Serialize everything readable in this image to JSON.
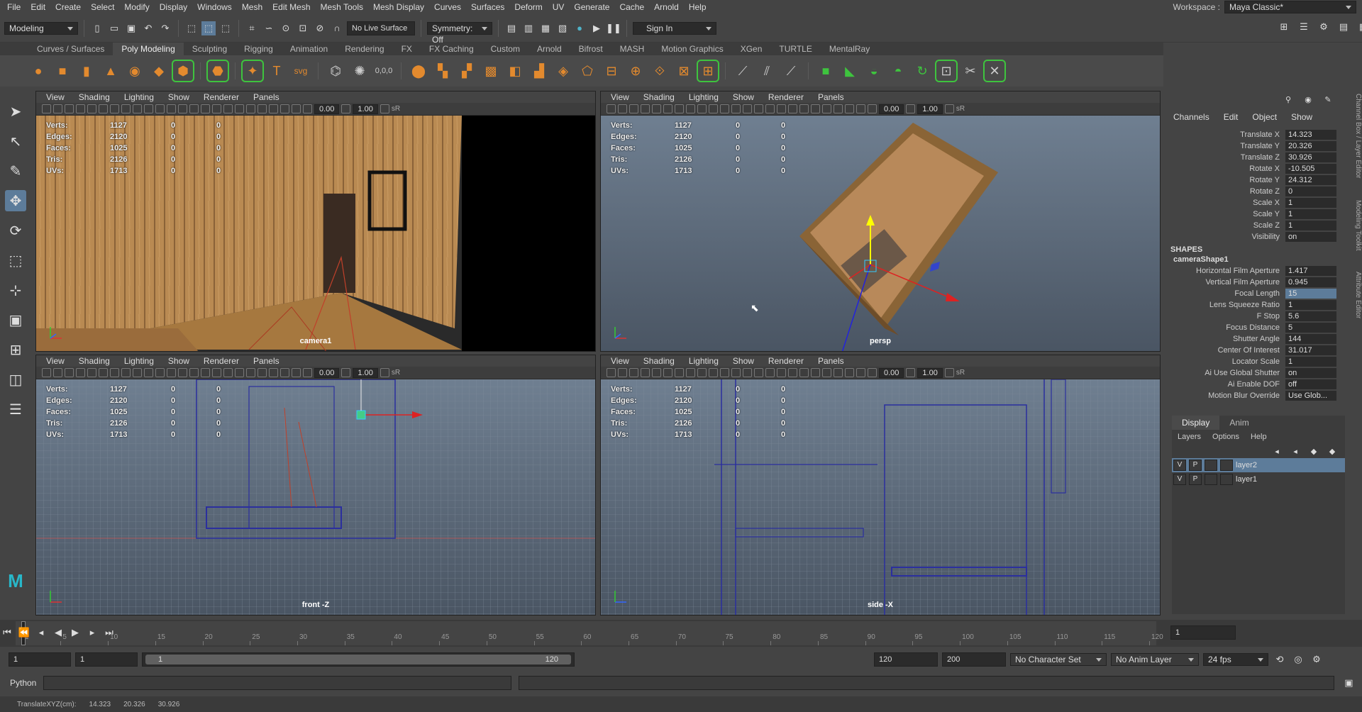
{
  "menubar": {
    "items": [
      "File",
      "Edit",
      "Create",
      "Select",
      "Modify",
      "Display",
      "Windows",
      "Mesh",
      "Edit Mesh",
      "Mesh Tools",
      "Mesh Display",
      "Curves",
      "Surfaces",
      "Deform",
      "UV",
      "Generate",
      "Cache",
      "Arnold",
      "Help"
    ],
    "workspace_label": "Workspace :",
    "workspace_value": "Maya Classic*"
  },
  "statusline": {
    "mode": "Modeling",
    "live_surface": "No Live Surface",
    "symmetry": "Symmetry: Off",
    "sign_in": "Sign In"
  },
  "shelf": {
    "tabs": [
      "Curves / Surfaces",
      "Poly Modeling",
      "Sculpting",
      "Rigging",
      "Animation",
      "Rendering",
      "FX",
      "FX Caching",
      "Custom",
      "Arnold",
      "Bifrost",
      "MASH",
      "Motion Graphics",
      "XGen",
      "TURTLE",
      "MentalRay"
    ],
    "active": "Poly Modeling"
  },
  "viewport_menu": [
    "View",
    "Shading",
    "Lighting",
    "Show",
    "Renderer",
    "Panels"
  ],
  "viewport_tool": {
    "near": "0.00",
    "gamma": "1.00",
    "srgb": "sR"
  },
  "hud": {
    "labels": [
      "Verts:",
      "Edges:",
      "Faces:",
      "Tris:",
      "UVs:"
    ],
    "values": [
      "1127",
      "2120",
      "1025",
      "2126",
      "1713"
    ],
    "sel": [
      "0",
      "0",
      "0",
      "0",
      "0"
    ],
    "comp": [
      "0",
      "0",
      "0",
      "0",
      "0"
    ]
  },
  "viewports": [
    {
      "name": "camera1"
    },
    {
      "name": "persp"
    },
    {
      "name": "front -Z"
    },
    {
      "name": "side -X"
    }
  ],
  "channelbox": {
    "menu": [
      "Channels",
      "Edit",
      "Object",
      "Show"
    ],
    "attrs": [
      [
        "Translate X",
        "14.323"
      ],
      [
        "Translate Y",
        "20.326"
      ],
      [
        "Translate Z",
        "30.926"
      ],
      [
        "Rotate X",
        "-10.505"
      ],
      [
        "Rotate Y",
        "24.312"
      ],
      [
        "Rotate Z",
        "0"
      ],
      [
        "Scale X",
        "1"
      ],
      [
        "Scale Y",
        "1"
      ],
      [
        "Scale Z",
        "1"
      ],
      [
        "Visibility",
        "on"
      ]
    ],
    "shapes_header": "SHAPES",
    "shape_name": "cameraShape1",
    "shape_attrs": [
      [
        "Horizontal Film Aperture",
        "1.417"
      ],
      [
        "Vertical Film Aperture",
        "0.945"
      ],
      [
        "Focal Length",
        "15"
      ],
      [
        "Lens Squeeze Ratio",
        "1"
      ],
      [
        "F Stop",
        "5.6"
      ],
      [
        "Focus Distance",
        "5"
      ],
      [
        "Shutter Angle",
        "144"
      ],
      [
        "Center Of Interest",
        "31.017"
      ],
      [
        "Locator Scale",
        "1"
      ],
      [
        "Ai Use Global Shutter",
        "on"
      ],
      [
        "Ai Enable DOF",
        "off"
      ],
      [
        "Motion Blur Override",
        "Use Glob..."
      ]
    ]
  },
  "layers": {
    "tabs": [
      "Display",
      "Anim"
    ],
    "menu": [
      "Layers",
      "Options",
      "Help"
    ],
    "items": [
      {
        "v": "V",
        "p": "P",
        "name": "layer2"
      },
      {
        "v": "V",
        "p": "P",
        "name": "layer1"
      }
    ]
  },
  "sidetabs": [
    "Channel Box / Layer Editor",
    "Modeling Toolkit",
    "Attribute Editor"
  ],
  "timeline": {
    "ticks": [
      "1",
      "5",
      "10",
      "15",
      "20",
      "25",
      "30",
      "35",
      "40",
      "45",
      "50",
      "55",
      "60",
      "65",
      "70",
      "75",
      "80",
      "85",
      "90",
      "95",
      "100",
      "105",
      "110",
      "115",
      "120"
    ],
    "current": "1"
  },
  "range": {
    "start": "1",
    "min": "1",
    "range_start": "1",
    "range_end": "120",
    "max": "120",
    "end": "200",
    "char_set": "No Character Set",
    "anim_layer": "No Anim Layer",
    "fps": "24 fps"
  },
  "cmdline": {
    "label": "Python"
  },
  "helpline": {
    "label": "TranslateXYZ(cm):",
    "x": "14.323",
    "y": "20.326",
    "z": "30.926"
  },
  "colors": {
    "accent": "#5d7c9a",
    "wood": "#b98a52",
    "wire": "#2b2f9e"
  }
}
